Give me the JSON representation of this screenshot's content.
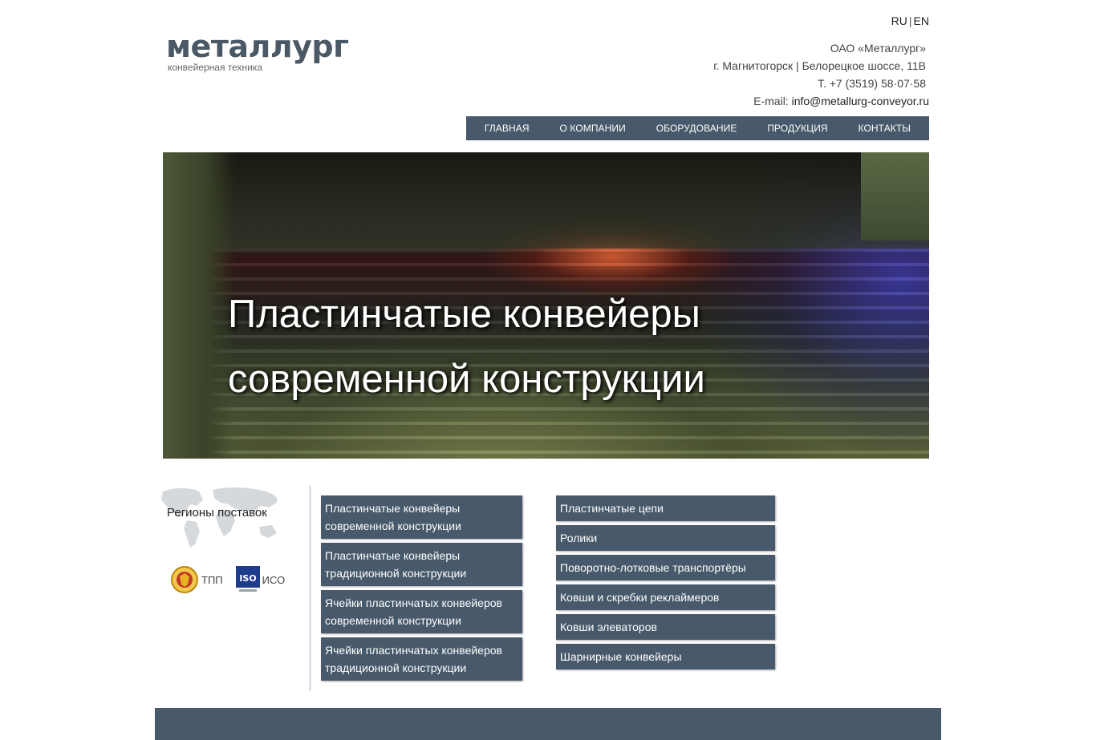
{
  "header": {
    "lang": {
      "ru": "RU",
      "separator": "|",
      "en": "EN"
    },
    "logo": {
      "title": "металлург",
      "subtitle": "конвейерная техника"
    },
    "contacts": {
      "company": "ОАО «Металлург»",
      "address": "г. Магнитогорск | Белорецкое шоссе, 11В",
      "phone": "Т. +7 (3519) 58·07·58",
      "email_label": "E-mail:",
      "email": "info@metallurg-conveyor.ru"
    },
    "nav": [
      "ГЛАВНАЯ",
      "О КОМПАНИИ",
      "ОБОРУДОВАНИЕ",
      "ПРОДУКЦИЯ",
      "КОНТАКТЫ"
    ]
  },
  "hero": {
    "line1": "Пластинчатые конвейеры",
    "line2": "современной конструкции"
  },
  "sidebar": {
    "regions": "Регионы поставок",
    "cert_tpp": "ТПП",
    "cert_iso": "ИСО"
  },
  "products_left": [
    {
      "line1": "Пластинчатые конвейеры",
      "line2": "современной конструкции"
    },
    {
      "line1": "Пластинчатые конвейеры",
      "line2": "традиционной конструкции"
    },
    {
      "line1": "Ячейки пластинчатых конвейеров",
      "line2": "современной конструкции"
    },
    {
      "line1": "Ячейки пластинчатых конвейеров",
      "line2": "традиционной конструкции"
    }
  ],
  "products_right": [
    "Пластинчатые цепи",
    "Ролики",
    "Поворотно-лотковые транспортёры",
    "Ковши и скребки реклаймеров",
    "Ковши элеваторов",
    "Шарнирные конвейеры"
  ],
  "colors": {
    "accent": "#47596a",
    "logo": "#4a5965"
  }
}
